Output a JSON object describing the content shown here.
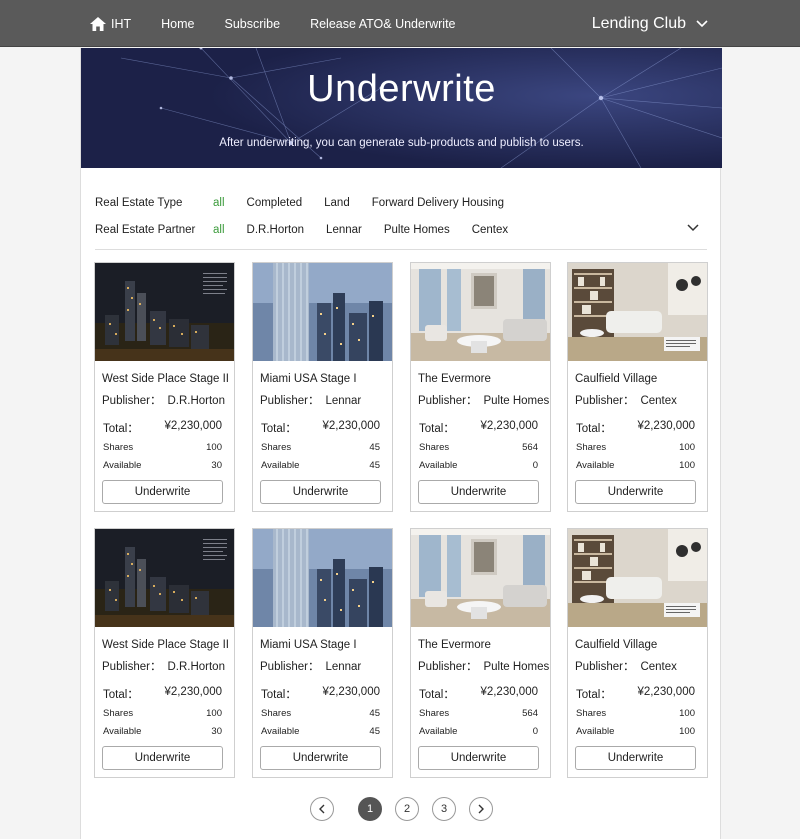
{
  "nav": {
    "home_icon_label": "IHT",
    "items": [
      "Home",
      "Subscribe",
      "Release ATO& Underwrite"
    ],
    "brand": "Lending Club"
  },
  "hero": {
    "title": "Underwrite",
    "subtitle": "After underwriting,  you can generate sub-products and publish to users."
  },
  "filters": {
    "type": {
      "label": "Real Estate Type",
      "options": [
        "all",
        "Completed",
        "Land",
        "Forward Delivery Housing"
      ],
      "selected": "all"
    },
    "partner": {
      "label": "Real Estate Partner",
      "options": [
        "all",
        "D.R.Horton",
        "Lennar",
        "Pulte Homes",
        "Centex"
      ],
      "selected": "all"
    }
  },
  "labels": {
    "publisher": "Publisher：",
    "total": "Total：",
    "shares": "Shares",
    "available": "Available",
    "button": "Underwrite"
  },
  "cards": [
    {
      "name": "West Side Place Stage II",
      "publisher": "D.R.Horton",
      "total": "¥2,230,000",
      "shares": "100",
      "available": "30",
      "image": "night-skyline"
    },
    {
      "name": "Miami USA Stage I",
      "publisher": "Lennar",
      "total": "¥2,230,000",
      "shares": "45",
      "available": "45",
      "image": "glass-tower"
    },
    {
      "name": "The Evermore",
      "publisher": "Pulte Homes",
      "total": "¥2,230,000",
      "shares": "564",
      "available": "0",
      "image": "living-room"
    },
    {
      "name": "Caulfield Village",
      "publisher": "Centex",
      "total": "¥2,230,000",
      "shares": "100",
      "available": "100",
      "image": "lounge-interior"
    },
    {
      "name": "West Side Place Stage II",
      "publisher": "D.R.Horton",
      "total": "¥2,230,000",
      "shares": "100",
      "available": "30",
      "image": "night-skyline"
    },
    {
      "name": "Miami USA Stage I",
      "publisher": "Lennar",
      "total": "¥2,230,000",
      "shares": "45",
      "available": "45",
      "image": "glass-tower"
    },
    {
      "name": "The Evermore",
      "publisher": "Pulte Homes",
      "total": "¥2,230,000",
      "shares": "564",
      "available": "0",
      "image": "living-room"
    },
    {
      "name": "Caulfield Village",
      "publisher": "Centex",
      "total": "¥2,230,000",
      "shares": "100",
      "available": "100",
      "image": "lounge-interior"
    }
  ],
  "pagination": {
    "pages": [
      "1",
      "2",
      "3"
    ],
    "current": "1"
  },
  "colors": {
    "topbar": "#5a5a5a",
    "hero": "#1f2450",
    "active_filter": "#3a9a3a",
    "active_page": "#555555"
  }
}
